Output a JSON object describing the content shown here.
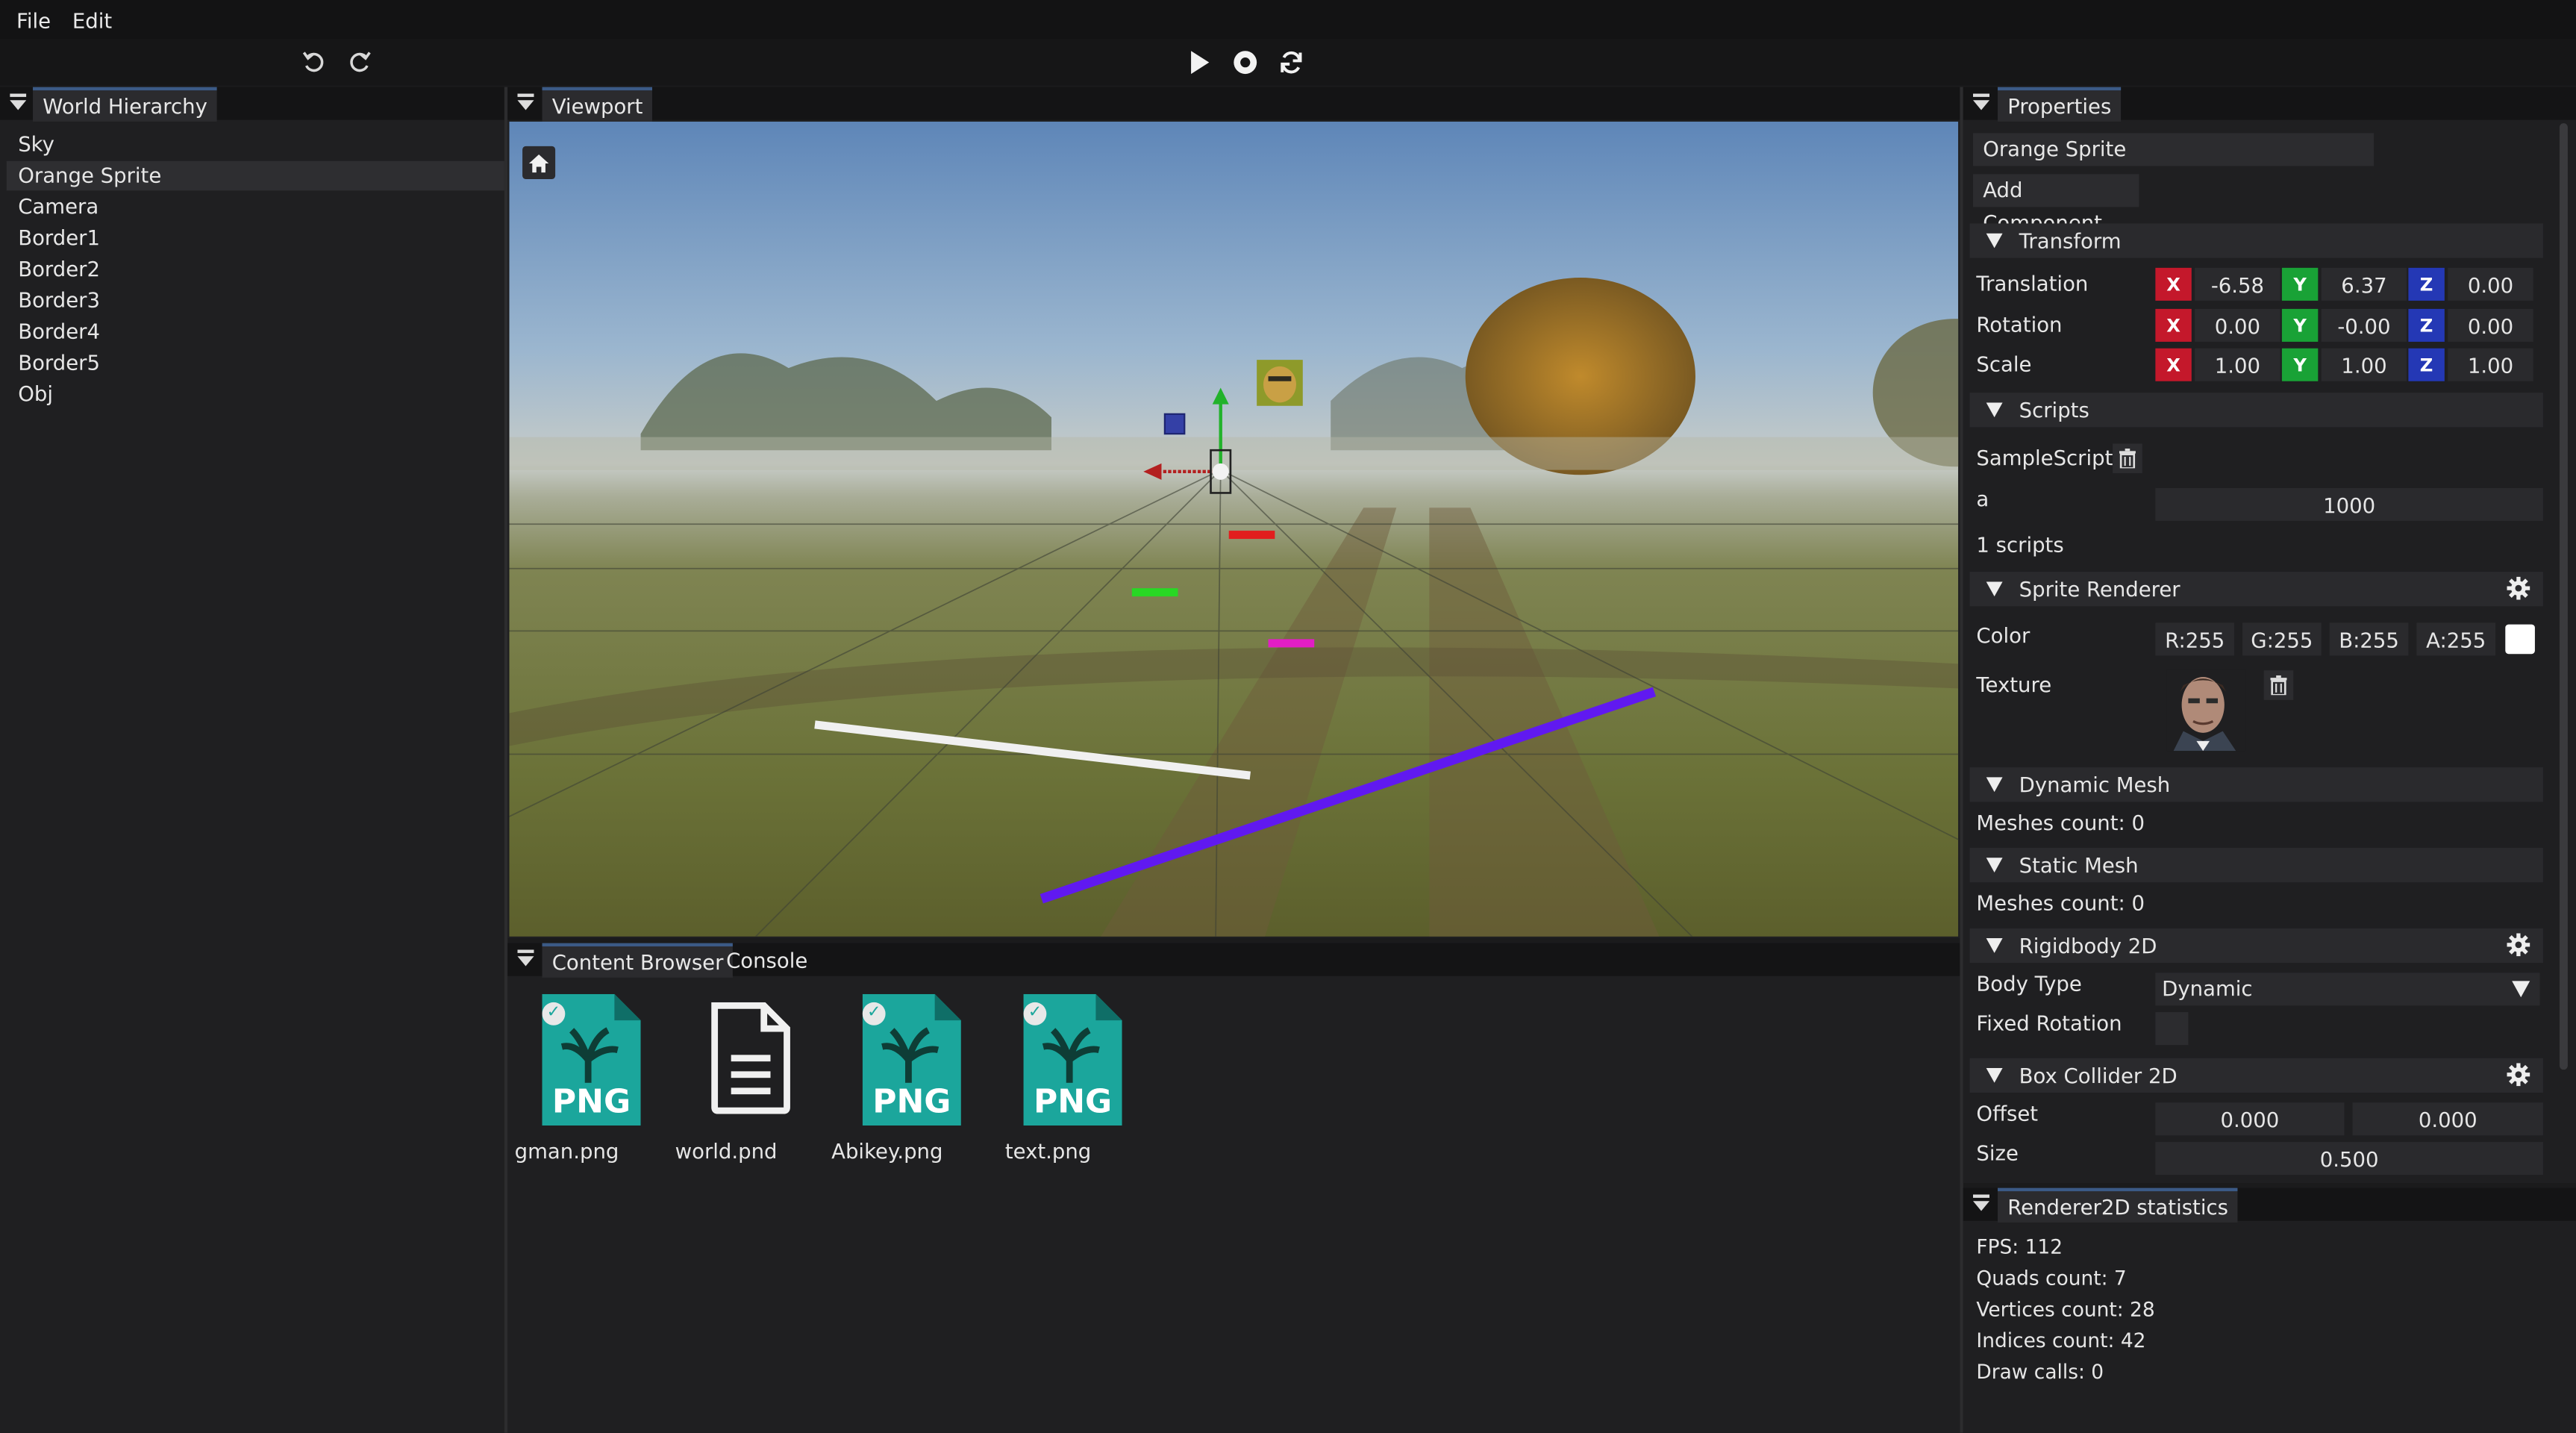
{
  "menu": {
    "file": "File",
    "edit": "Edit"
  },
  "toolbar": {
    "undo_icon": "undo-icon",
    "redo_icon": "redo-icon",
    "play_icon": "play-icon",
    "simulate_icon": "record-icon",
    "reload_icon": "refresh-icon"
  },
  "hierarchy": {
    "tab": "World Hierarchy",
    "items": [
      "Sky",
      "Orange Sprite",
      "Camera",
      "Border1",
      "Border2",
      "Border3",
      "Border4",
      "Border5",
      "Obj"
    ],
    "selected": "Orange Sprite"
  },
  "viewport": {
    "tab": "Viewport",
    "home_icon": "home-icon"
  },
  "bottom": {
    "tabs": [
      "Content Browser",
      "Console"
    ],
    "files": [
      {
        "name": "gman.png",
        "icon": "png-file-icon",
        "checked": true
      },
      {
        "name": "world.pnd",
        "icon": "document-icon",
        "checked": false
      },
      {
        "name": "Abikey.png",
        "icon": "png-file-icon",
        "checked": true
      },
      {
        "name": "text.png",
        "icon": "png-file-icon",
        "checked": true
      }
    ],
    "png_label": "PNG"
  },
  "properties": {
    "tab": "Properties",
    "entity_name": "Orange Sprite",
    "add_component": "Add Component",
    "transform": {
      "title": "Transform",
      "rows": [
        {
          "label": "Translation",
          "x": "-6.58",
          "y": "6.37",
          "z": "0.00"
        },
        {
          "label": "Rotation",
          "x": "0.00",
          "y": "-0.00",
          "z": "0.00"
        },
        {
          "label": "Scale",
          "x": "1.00",
          "y": "1.00",
          "z": "1.00"
        }
      ],
      "axis": {
        "x": "X",
        "y": "Y",
        "z": "Z"
      }
    },
    "scripts": {
      "title": "Scripts",
      "script_name": "SampleScript",
      "field_label": "a",
      "field_value": "1000",
      "count": "1 scripts"
    },
    "sprite": {
      "title": "Sprite Renderer",
      "color_label": "Color",
      "r": "R:255",
      "g": "G:255",
      "b": "B:255",
      "a": "A:255",
      "texture_label": "Texture"
    },
    "dynamic_mesh": {
      "title": "Dynamic Mesh",
      "count": "Meshes count: 0"
    },
    "static_mesh": {
      "title": "Static Mesh",
      "count": "Meshes count: 0"
    },
    "rigidbody": {
      "title": "Rigidbody 2D",
      "body_type_label": "Body Type",
      "body_type_value": "Dynamic",
      "fixed_rotation_label": "Fixed Rotation"
    },
    "box_collider": {
      "title": "Box Collider 2D",
      "offset_label": "Offset",
      "offset_x": "0.000",
      "offset_y": "0.000",
      "size_label": "Size",
      "size_value": "0.500"
    }
  },
  "stats": {
    "tab": "Renderer2D statistics",
    "fps": "FPS: 112",
    "quads": "Quads count: 7",
    "vertices": "Vertices count: 28",
    "indices": "Indices count: 42",
    "draw_calls": "Draw calls: 0"
  },
  "colors": {
    "accent": "#3b5a86",
    "x_axis": "#c4182b",
    "y_axis": "#19a236",
    "z_axis": "#2438b5",
    "png_teal": "#1ba69c"
  }
}
